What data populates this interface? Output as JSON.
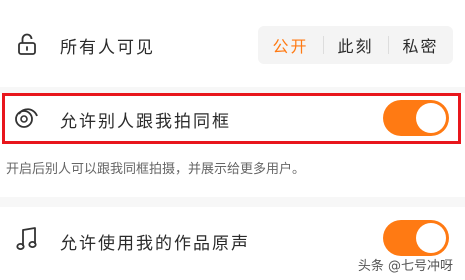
{
  "visibility": {
    "label": "所有人可见",
    "icon": "lock-icon",
    "options": [
      "公开",
      "此刻",
      "私密"
    ],
    "selected": "公开"
  },
  "coframe": {
    "label": "允许别人跟我拍同框",
    "icon": "coframe-icon",
    "enabled": true,
    "hint": "开启后别人可以跟我同框拍摄，并展示给更多用户。"
  },
  "original_sound": {
    "label": "允许使用我的作品原声",
    "icon": "music-note-icon",
    "enabled": true
  },
  "watermark": "头条 @七号冲呀",
  "colors": {
    "accent": "#ff7a13",
    "highlight_border": "#e8161c",
    "text": "#2b2b2b",
    "muted": "#666666"
  }
}
